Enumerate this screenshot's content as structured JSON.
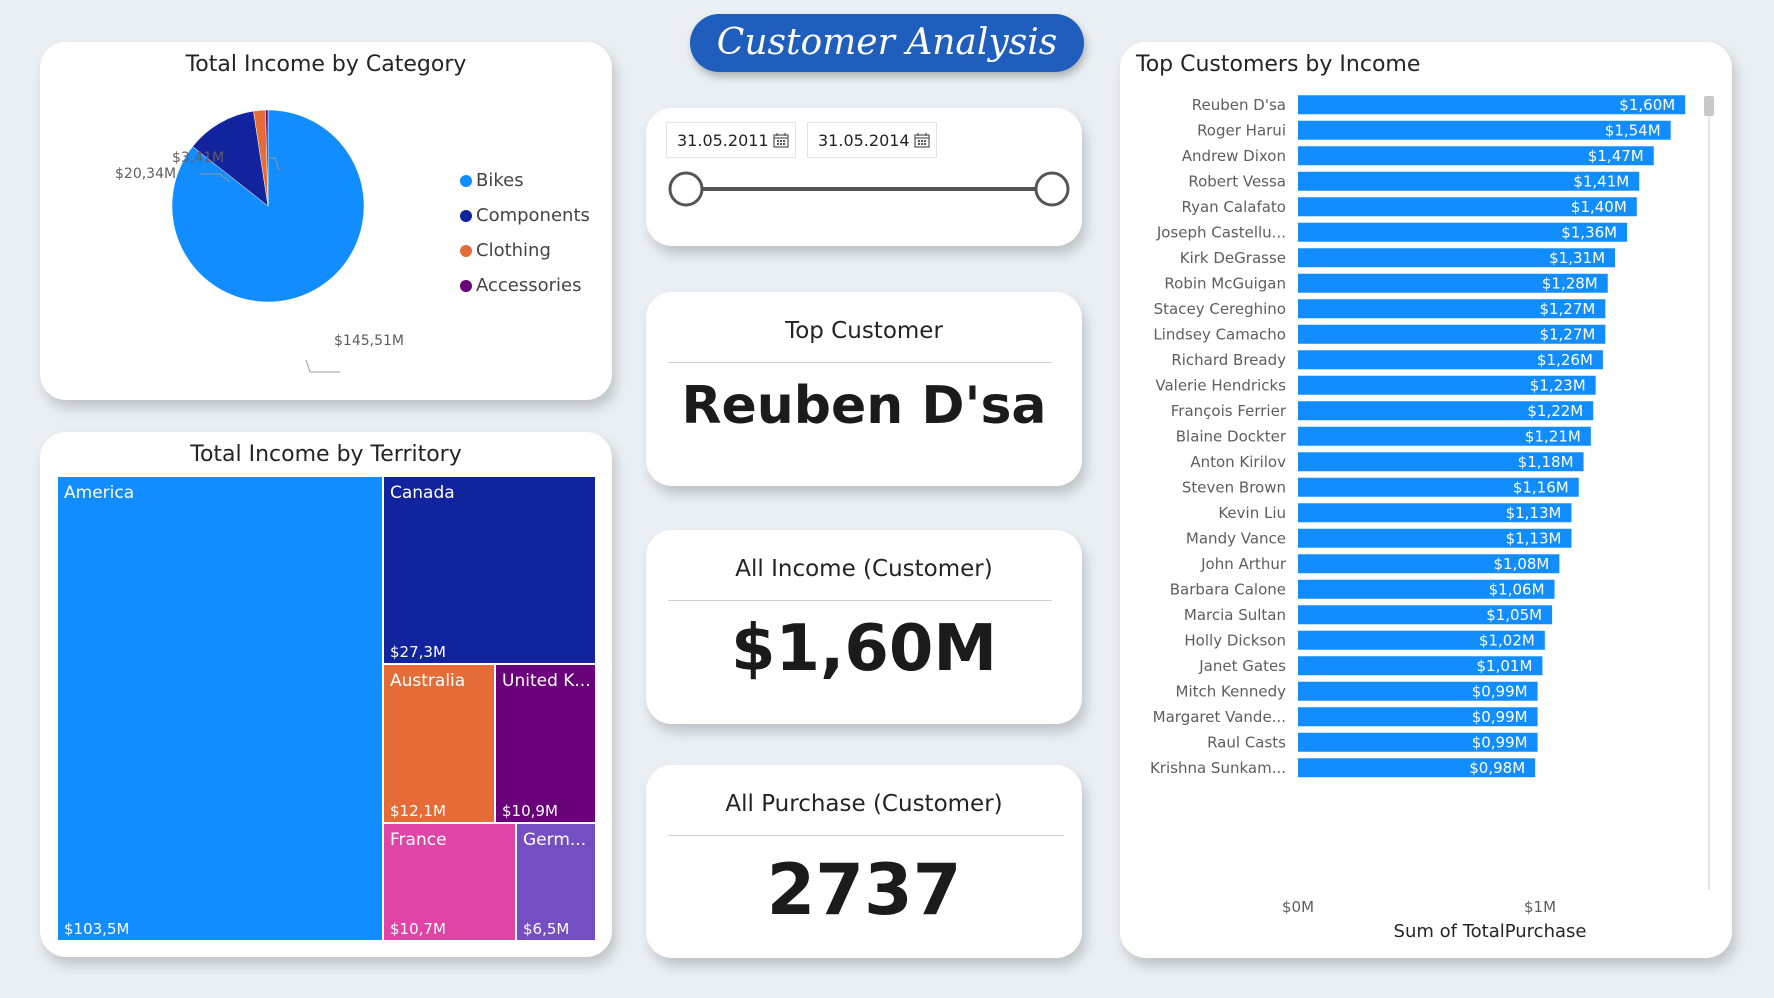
{
  "page_title": "Customer Analysis",
  "pie": {
    "title": "Total Income by Category",
    "legend": [
      {
        "name": "Bikes",
        "color": "#118dff"
      },
      {
        "name": "Components",
        "color": "#12239e"
      },
      {
        "name": "Clothing",
        "color": "#e66c37"
      },
      {
        "name": "Accessories",
        "color": "#6b007b"
      }
    ],
    "labels": {
      "bikes": "$145,51M",
      "components": "$20,34M",
      "clothing": "$3,41M"
    }
  },
  "treemap": {
    "title": "Total Income by Territory",
    "tiles": {
      "america": {
        "name": "America",
        "value": "$103,5M",
        "color": "#118dff"
      },
      "canada": {
        "name": "Canada",
        "value": "$27,3M",
        "color": "#12239e"
      },
      "australia": {
        "name": "Australia",
        "value": "$12,1M",
        "color": "#e66c37"
      },
      "uk": {
        "name": "United K...",
        "value": "$10,9M",
        "color": "#6b007b"
      },
      "france": {
        "name": "France",
        "value": "$10,7M",
        "color": "#e044a7"
      },
      "germany": {
        "name": "Germ...",
        "value": "$6,5M",
        "color": "#744ec2"
      }
    }
  },
  "slicer": {
    "start_date": "31.05.2011",
    "end_date": "31.05.2014"
  },
  "kpis": {
    "top_customer": {
      "title": "Top Customer",
      "value": "Reuben D'sa"
    },
    "all_income": {
      "title": "All Income (Customer)",
      "value": "$1,60M"
    },
    "all_purchase": {
      "title": "All Purchase (Customer)",
      "value": "2737"
    }
  },
  "bar_chart": {
    "title": "Top Customers by Income",
    "xlabel": "Sum of TotalPurchase",
    "tick_labels": [
      "$0M",
      "$1M"
    ]
  },
  "chart_data": [
    {
      "type": "pie",
      "title": "Total Income by Category",
      "categories": [
        "Bikes",
        "Components",
        "Clothing",
        "Accessories"
      ],
      "values": [
        145.51,
        20.34,
        3.41,
        0.7
      ],
      "data_labels": [
        "$145,51M",
        "$20,34M",
        "$3,41M",
        ""
      ],
      "unit": "$M"
    },
    {
      "type": "treemap",
      "title": "Total Income by Territory",
      "categories": [
        "America",
        "Canada",
        "Australia",
        "United K...",
        "France",
        "Germ..."
      ],
      "values": [
        103.5,
        27.3,
        12.1,
        10.9,
        10.7,
        6.5
      ],
      "unit": "$M"
    },
    {
      "type": "bar",
      "orientation": "horizontal",
      "title": "Top Customers by Income",
      "xlabel": "Sum of TotalPurchase",
      "xlim": [
        0,
        1.6
      ],
      "xticks": [
        0,
        1
      ],
      "categories": [
        "Reuben D'sa",
        "Roger Harui",
        "Andrew Dixon",
        "Robert Vessa",
        "Ryan Calafato",
        "Joseph Castellu...",
        "Kirk DeGrasse",
        "Robin McGuigan",
        "Stacey Cereghino",
        "Lindsey Camacho",
        "Richard Bready",
        "Valerie Hendricks",
        "François Ferrier",
        "Blaine Dockter",
        "Anton Kirilov",
        "Steven Brown",
        "Kevin Liu",
        "Mandy Vance",
        "John Arthur",
        "Barbara Calone",
        "Marcia Sultan",
        "Holly Dickson",
        "Janet Gates",
        "Mitch Kennedy",
        "Margaret Vande...",
        "Raul Casts",
        "Krishna Sunkam..."
      ],
      "values": [
        1.6,
        1.54,
        1.47,
        1.41,
        1.4,
        1.36,
        1.31,
        1.28,
        1.27,
        1.27,
        1.26,
        1.23,
        1.22,
        1.21,
        1.18,
        1.16,
        1.13,
        1.13,
        1.08,
        1.06,
        1.05,
        1.02,
        1.01,
        0.99,
        0.99,
        0.99,
        0.98
      ],
      "data_labels": [
        "$1,60M",
        "$1,54M",
        "$1,47M",
        "$1,41M",
        "$1,40M",
        "$1,36M",
        "$1,31M",
        "$1,28M",
        "$1,27M",
        "$1,27M",
        "$1,26M",
        "$1,23M",
        "$1,22M",
        "$1,21M",
        "$1,18M",
        "$1,16M",
        "$1,13M",
        "$1,13M",
        "$1,08M",
        "$1,06M",
        "$1,05M",
        "$1,02M",
        "$1,01M",
        "$0,99M",
        "$0,99M",
        "$0,99M",
        "$0,98M"
      ],
      "color": "#118dff"
    }
  ]
}
